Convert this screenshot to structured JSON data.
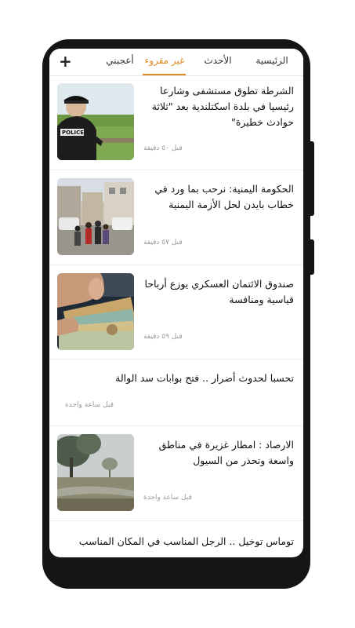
{
  "tabs": {
    "home": "الرئيسية",
    "latest": "الأحدث",
    "unread": "غير مقروء",
    "liked": "أعجبني",
    "add": "+"
  },
  "colors": {
    "accent": "#e08a1e"
  },
  "articles": [
    {
      "title_l1": "الشرطة تطوق مستشفى وشارعا",
      "title_l2": "رئيسيا في بلدة اسكتلندية بعد \"ثلاثة",
      "title_l3": "حوادث خطيرة\"",
      "time": "قبل ٥٠ دقيقة",
      "image": "police-officer-photo"
    },
    {
      "title_l1": "الحكومة اليمنية: نرحب بما ورد في",
      "title_l2": "خطاب بايدن لحل الأزمة اليمنية",
      "time": "قبل ٥٧ دقيقة",
      "image": "street-crowd-photo"
    },
    {
      "title_l1": "صندوق الائتمان العسكري يوزع أرباحا",
      "title_l2": "قياسية ومنافسة",
      "time": "قبل ٥٩ دقيقة",
      "image": "money-hand-photo"
    },
    {
      "title_l1": "تحسبا لحدوث أضرار .. فتح بوابات سد الوالة",
      "time": "قبل ساعة واحدة"
    },
    {
      "title_l1": "الارصاد : امطار غزيرة في مناطق",
      "title_l2": "واسعة وتحذر من السيول",
      "time": "قبل ساعة واحدة",
      "image": "rainy-field-photo"
    },
    {
      "title_l1": "توماس توخيل .. الرجل المناسب في المكان المناسب"
    }
  ]
}
